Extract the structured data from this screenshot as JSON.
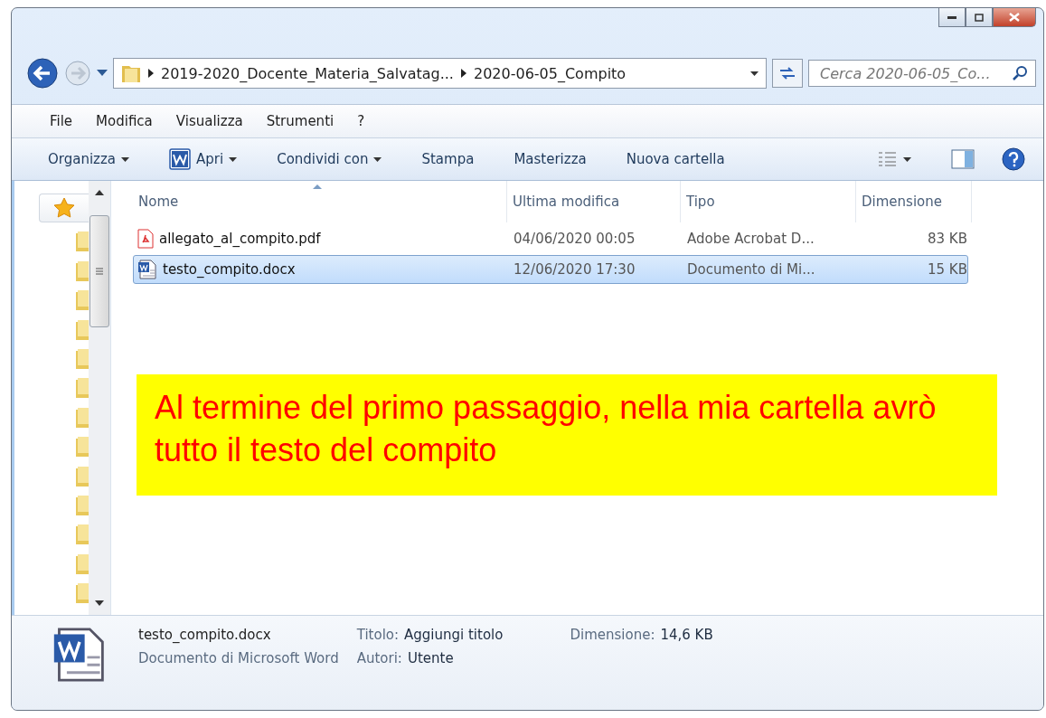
{
  "address": {
    "segments": [
      "2019-2020_Docente_Materia_Salvatag...",
      "2020-06-05_Compito"
    ]
  },
  "search": {
    "placeholder": "Cerca 2020-06-05_Co..."
  },
  "menu": [
    "File",
    "Modifica",
    "Visualizza",
    "Strumenti",
    "?"
  ],
  "toolbar": [
    {
      "label": "Organizza",
      "kind": "dropdown"
    },
    {
      "label": "Apri",
      "kind": "word-dropdown"
    },
    {
      "label": "Condividi con",
      "kind": "dropdown"
    },
    {
      "label": "Stampa",
      "kind": "plain"
    },
    {
      "label": "Masterizza",
      "kind": "plain"
    },
    {
      "label": "Nuova cartella",
      "kind": "plain"
    }
  ],
  "columns": [
    "Nome",
    "Ultima modifica",
    "Tipo",
    "Dimensione"
  ],
  "files": [
    {
      "name": "allegato_al_compito.pdf",
      "modified": "04/06/2020 00:05",
      "type": "Adobe Acrobat D...",
      "size": "83 KB",
      "kind": "pdf",
      "selected": false
    },
    {
      "name": "testo_compito.docx",
      "modified": "12/06/2020 17:30",
      "type": "Documento di Mi...",
      "size": "15 KB",
      "kind": "word",
      "selected": true
    }
  ],
  "note": "Al termine del primo passaggio, nella mia cartella avrò tutto il testo del compito",
  "details": {
    "name": "testo_compito.docx",
    "type": "Documento di Microsoft Word",
    "fields": [
      {
        "label": "Titolo:",
        "value": "Aggiungi titolo"
      },
      {
        "label": "Autori:",
        "value": "Utente"
      },
      {
        "label": "Dimensione:",
        "value": "14,6 KB"
      }
    ]
  }
}
